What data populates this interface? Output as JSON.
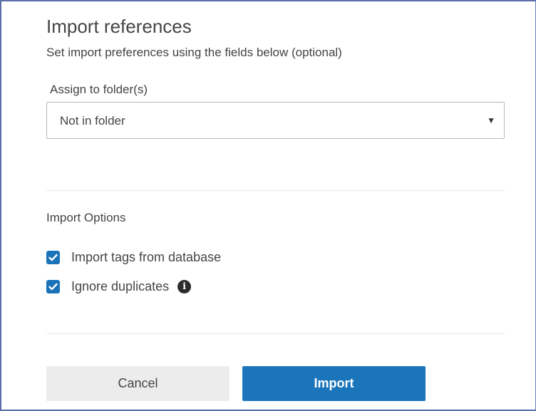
{
  "dialog": {
    "title": "Import references",
    "subtitle": "Set import preferences using the fields below (optional)"
  },
  "folder": {
    "label": "Assign to folder(s)",
    "selected": "Not in folder",
    "caret": "▼"
  },
  "options": {
    "heading": "Import Options",
    "items": [
      {
        "label": "Import tags from database",
        "checked": true
      },
      {
        "label": "Ignore duplicates",
        "checked": true,
        "info_icon": "info-circle-icon",
        "info_glyph": "i"
      }
    ]
  },
  "buttons": {
    "cancel_label": "Cancel",
    "import_label": "Import"
  },
  "colors": {
    "accent": "#1b75bb",
    "checkbox": "#1a73b9",
    "cancel_bg": "#ececec",
    "frame_border": "#5b6fa8"
  }
}
